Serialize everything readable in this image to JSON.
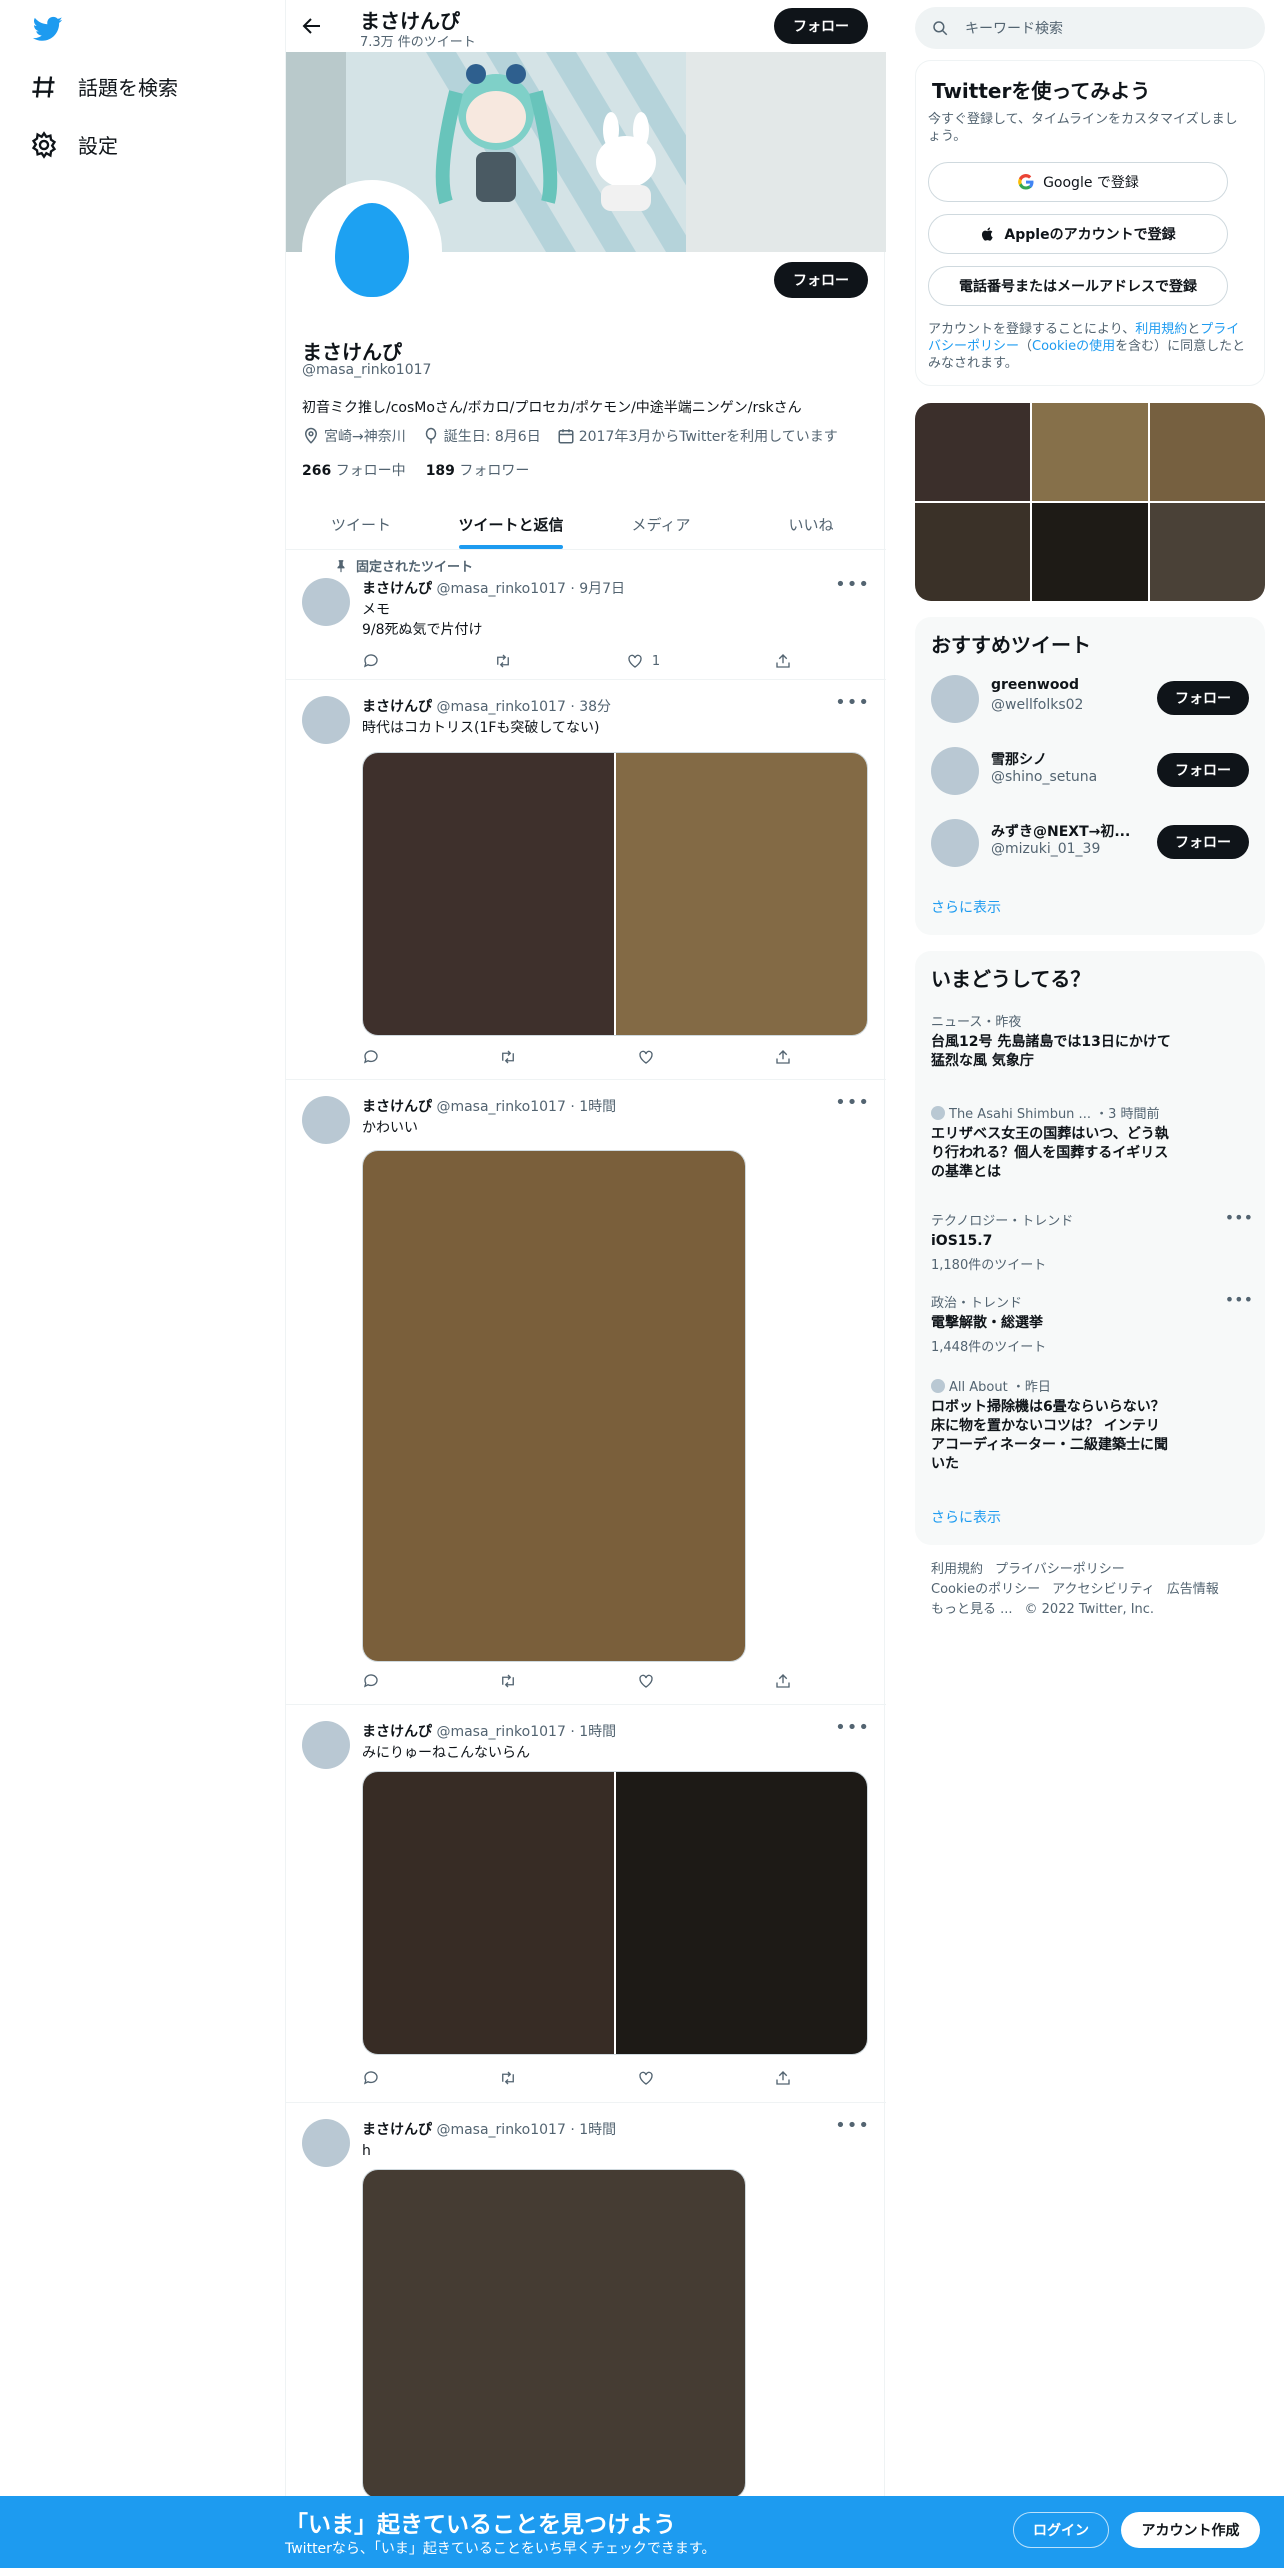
{
  "nav": {
    "logo_icon": "twitter-bird-icon",
    "explore_label": "話題を検索",
    "settings_label": "設定"
  },
  "header": {
    "name": "まさけんぴ",
    "tweet_count": "7.3万 件のツイート",
    "follow_label": "フォロー"
  },
  "profile": {
    "name": "まさけんぴ",
    "handle": "@masa_rinko1017",
    "bio": "初音ミク推し/cosMoさん/ボカロ/プロセカ/ポケモン/中途半端ニンゲン/rskさん",
    "location": "宮崎→神奈川",
    "birthday": "誕生日: 8月6日",
    "joined": "2017年3月からTwitterを利用しています",
    "following_count": "266",
    "following_label": "フォロー中",
    "followers_count": "189",
    "followers_label": "フォロワー",
    "follow_label": "フォロー"
  },
  "tabs": [
    {
      "label": "ツイート",
      "active": false
    },
    {
      "label": "ツイートと返信",
      "active": true
    },
    {
      "label": "メディア",
      "active": false
    },
    {
      "label": "いいね",
      "active": false
    }
  ],
  "pinned_label": "固定されたツイート",
  "tweets": [
    {
      "name": "まさけんぴ",
      "handle": "@masa_rinko1017",
      "time": "9月7日",
      "text1": "メモ",
      "text2": "9/8死ぬ気で片付け",
      "likes": "1"
    },
    {
      "name": "まさけんぴ",
      "handle": "@masa_rinko1017",
      "time": "38分",
      "text1": "時代はコカトリス(1Fも突破してない)",
      "media_colors": [
        "#3e302c",
        "#836a45"
      ]
    },
    {
      "name": "まさけんぴ",
      "handle": "@masa_rinko1017",
      "time": "1時間",
      "text1": "かわいい",
      "media_colors": [
        "#7a5f3b"
      ]
    },
    {
      "name": "まさけんぴ",
      "handle": "@masa_rinko1017",
      "time": "1時間",
      "text1": "みにりゅーねこんないらん",
      "media_colors": [
        "#372c25",
        "#1d1a16"
      ]
    },
    {
      "name": "まさけんぴ",
      "handle": "@masa_rinko1017",
      "time": "1時間",
      "text1": "h",
      "media_colors": [
        "#453c33"
      ]
    }
  ],
  "search": {
    "placeholder": "キーワード検索"
  },
  "signup": {
    "title": "Twitterを使ってみよう",
    "subtitle": "今すぐ登録して、タイムラインをカスタマイズしましょう。",
    "google_label": "Google で登録",
    "apple_label": "Appleのアカウントで登録",
    "phone_label": "電話番号またはメールアドレスで登録",
    "legal_1": "アカウントを登録することにより、",
    "legal_terms": "利用規約",
    "legal_2": "と",
    "legal_privacy": "プライバシーポリシー",
    "legal_3": "（",
    "legal_cookie": "Cookieの使用",
    "legal_4": "を含む）に同意したとみなされます。"
  },
  "media_grid_colors": [
    "#3b2f2b",
    "#86704a",
    "#766040",
    "#3a3128",
    "#1e1b16",
    "#4a4137"
  ],
  "who_to_follow": {
    "title": "おすすめツイート",
    "users": [
      {
        "name": "greenwood",
        "handle": "@wellfolks02"
      },
      {
        "name": "雪那シノ",
        "handle": "@shino_setuna"
      },
      {
        "name": "みずき@NEXT→初...",
        "handle": "@mizuki_01_39"
      }
    ],
    "follow_label": "フォロー",
    "show_more": "さらに表示"
  },
  "trends": {
    "title": "いまどうしてる？",
    "items": [
      {
        "category": "ニュース・昨夜",
        "title": "台風12号 先島諸島では13日にかけて猛烈な風 気象庁"
      },
      {
        "category": "The Asahi Shimbun ... ・3 時間前",
        "title": "エリザベス女王の国葬はいつ、どう執り行われる？個人を国葬するイギリスの基準とは"
      },
      {
        "category": "テクノロジー・トレンド",
        "title": "iOS15.7",
        "count": "1,180件のツイート"
      },
      {
        "category": "政治・トレンド",
        "title": "電撃解散・総選挙",
        "count": "1,448件のツイート"
      },
      {
        "category": "All About ・昨日",
        "title": "ロボット掃除機は6畳ならいらない？ 床に物を置かないコツは？ インテリアコーディネーター・二級建築士に聞いた"
      }
    ],
    "show_more": "さらに表示"
  },
  "footer": {
    "terms": "利用規約",
    "privacy": "プライバシーポリシー",
    "cookie": "Cookieのポリシー",
    "accessibility": "アクセシビリティ",
    "ads": "広告情報",
    "more": "もっと見る ...",
    "copyright": "© 2022 Twitter, Inc."
  },
  "bottom_bar": {
    "title": "「いま」起きていることを見つけよう",
    "subtitle": "Twitterなら、「いま」起きていることをいち早くチェックできます。",
    "login_label": "ログイン",
    "signup_label": "アカウント作成"
  },
  "colors": {
    "accent": "#1d9bf0",
    "dark": "#0f1419",
    "muted": "#536471"
  }
}
